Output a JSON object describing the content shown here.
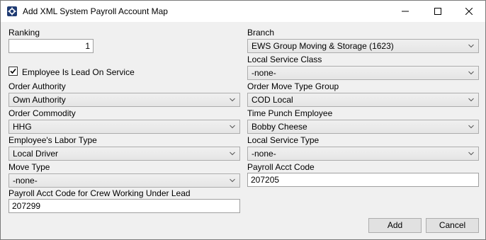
{
  "window": {
    "title": "Add XML System Payroll Account Map",
    "minimize_glyph": "—",
    "maximize_glyph": "☐",
    "close_glyph": "✕"
  },
  "form": {
    "ranking": {
      "label": "Ranking",
      "value": "1"
    },
    "lead_on_service": {
      "label": "Employee Is Lead On Service",
      "checked": true
    },
    "order_authority": {
      "label": "Order Authority",
      "value": "Own Authority"
    },
    "order_commodity": {
      "label": "Order Commodity",
      "value": "HHG"
    },
    "labor_type": {
      "label": "Employee's Labor Type",
      "value": "Local Driver"
    },
    "move_type": {
      "label": "Move Type",
      "value": "-none-"
    },
    "crew_acct_code": {
      "label": "Payroll Acct Code for Crew Working Under Lead",
      "value": "207299"
    },
    "branch": {
      "label": "Branch",
      "value": "EWS Group Moving & Storage (1623)"
    },
    "local_service_class": {
      "label": "Local Service Class",
      "value": "-none-"
    },
    "order_move_type_group": {
      "label": "Order Move Type Group",
      "value": "COD Local"
    },
    "time_punch_employee": {
      "label": "Time Punch Employee",
      "value": "Bobby Cheese"
    },
    "local_service_type": {
      "label": "Local Service Type",
      "value": "-none-"
    },
    "payroll_acct_code": {
      "label": "Payroll Acct Code",
      "value": "207205"
    }
  },
  "buttons": {
    "add": "Add",
    "cancel": "Cancel"
  },
  "icons": {
    "app": "gear-icon",
    "dropdown": "chevron-down-icon",
    "check": "checkmark-icon"
  }
}
